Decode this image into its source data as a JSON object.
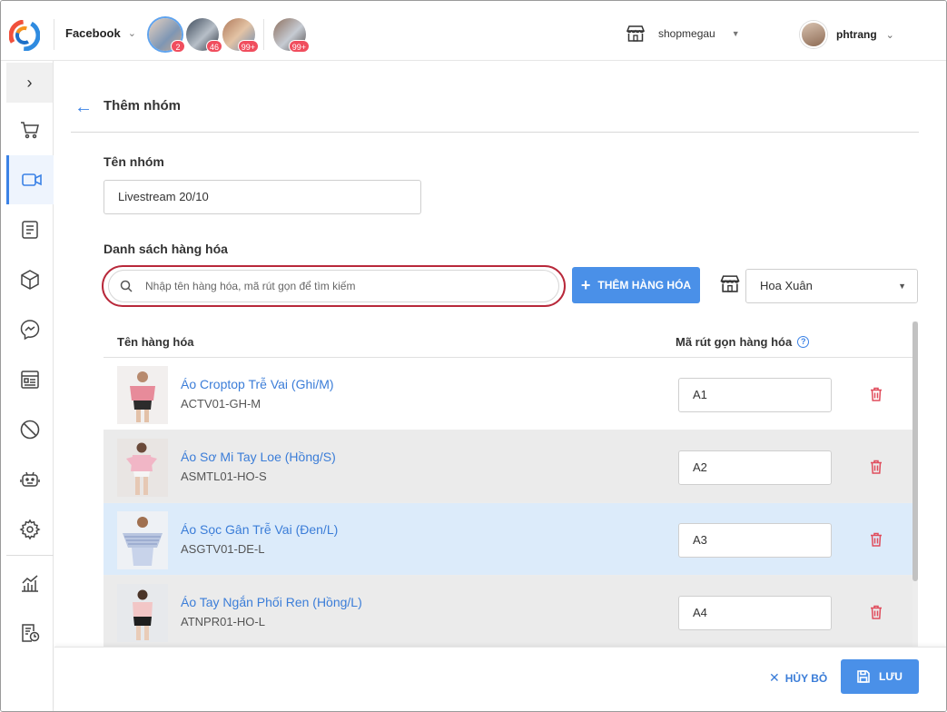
{
  "topbar": {
    "channel": "Facebook",
    "pages": [
      {
        "badge": "2",
        "active": true
      },
      {
        "badge": "46",
        "active": false
      },
      {
        "badge": "99+",
        "active": false
      },
      {
        "badge": "99+",
        "active": false
      }
    ],
    "shop_name": "shopmegau",
    "user_name": "phtrang"
  },
  "sidebar": {
    "items": [
      {
        "icon": "cart-icon"
      },
      {
        "icon": "video-icon",
        "active": true
      },
      {
        "icon": "document-icon"
      },
      {
        "icon": "box-icon"
      },
      {
        "icon": "messenger-icon"
      },
      {
        "icon": "contact-card-icon"
      },
      {
        "icon": "block-icon"
      },
      {
        "icon": "robot-icon"
      },
      {
        "icon": "settings-icon"
      },
      {
        "icon": "chart-icon"
      },
      {
        "icon": "report-clock-icon"
      }
    ]
  },
  "page": {
    "title": "Thêm nhóm",
    "group_name_label": "Tên nhóm",
    "group_name_value": "Livestream 20/10",
    "product_list_label": "Danh sách hàng hóa",
    "search_placeholder": "Nhập tên hàng hóa, mã rút gọn để tìm kiếm",
    "add_button": "THÊM HÀNG HÓA",
    "store_selected": "Hoa Xuân"
  },
  "table": {
    "col_name": "Tên hàng hóa",
    "col_code": "Mã rút gọn",
    "col_code_overlay": "hàng hóa",
    "help": "?",
    "rows": [
      {
        "name": "Áo Croptop Trễ Vai (Ghi/M)",
        "sku": "ACTV01-GH-M",
        "code": "A1",
        "style": "white"
      },
      {
        "name": "Áo Sơ Mi Tay Loe (Hồng/S)",
        "sku": "ASMTL01-HO-S",
        "code": "A2",
        "style": "alt"
      },
      {
        "name": "Áo Sọc Gân Trễ Vai (Đen/L)",
        "sku": "ASGTV01-DE-L",
        "code": "A3",
        "style": "selected"
      },
      {
        "name": "Áo Tay Ngắn Phối Ren (Hồng/L)",
        "sku": "ATNPR01-HO-L",
        "code": "A4",
        "style": "alt"
      }
    ]
  },
  "footer": {
    "cancel": "HỦY BỎ",
    "save": "LƯU"
  },
  "colors": {
    "accent": "#4a90e8",
    "link": "#3b7dd8",
    "danger": "#e04c5c",
    "highlight_ring": "#b8283a"
  }
}
